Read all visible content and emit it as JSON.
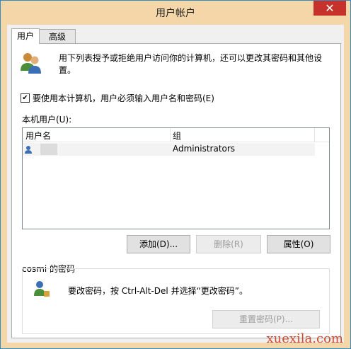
{
  "window": {
    "title": "用户帐户",
    "close_glyph": "✕"
  },
  "tabs": [
    {
      "label": "用户",
      "active": true
    },
    {
      "label": "高级",
      "active": false
    }
  ],
  "intro_text": "用下列表授予或拒绝用户访问你的计算机，还可以更改其密码和其他设置。",
  "require_login": {
    "label": "要使用本计算机，用户必须输入用户名和密码(E)",
    "checked": true,
    "check_glyph": "✔"
  },
  "users_section": {
    "label": "本机用户(U):",
    "columns": [
      "用户名",
      "组"
    ],
    "rows": [
      {
        "name": "",
        "group": "Administrators"
      }
    ]
  },
  "buttons": {
    "add": "添加(D)...",
    "remove": "删除(R)",
    "properties": "属性(O)"
  },
  "password_group": {
    "title": "cosmi 的密码",
    "text": "要改密码，按 Ctrl-Alt-Del 并选择“更改密码”。",
    "reset_button": "重置密码(P)..."
  },
  "watermark": "xuexila.com",
  "colors": {
    "title_bar": "#f4d6a8",
    "close": "#c7312b",
    "border": "#2d8ec4"
  }
}
